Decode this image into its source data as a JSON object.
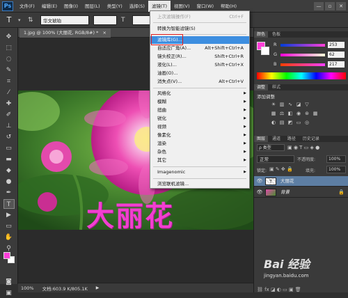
{
  "app": {
    "logo": "Ps"
  },
  "menubar": {
    "items": [
      "文件(F)",
      "编辑(E)",
      "图像(I)",
      "图层(L)",
      "类型(Y)",
      "选择(S)",
      "滤镜(T)",
      "视图(V)",
      "窗口(W)",
      "帮助(H)"
    ],
    "active_index": 6,
    "window_buttons": [
      "—",
      "▫",
      "✕"
    ]
  },
  "options_bar": {
    "tool_icon": "T",
    "font_family": "华文琥珀",
    "antialias_label": "aa"
  },
  "document": {
    "tab_label": "1.jpg @ 100% (大丽花, RGB/8#) *",
    "close_symbol": "×",
    "canvas_text": "大丽花"
  },
  "status_bar": {
    "zoom": "100%",
    "doc_info": "文档:603.9 K/805.1K"
  },
  "filter_menu": {
    "items": [
      {
        "label": "上次滤镜操作(F)",
        "shortcut": "Ctrl+F",
        "disabled": true
      },
      {
        "label": "转换为智能滤镜(S)",
        "shortcut": ""
      },
      {
        "label": "滤镜库(G)...",
        "shortcut": "",
        "highlighted": true
      },
      {
        "label": "自适应广角(A)...",
        "shortcut": "Alt+Shift+Ctrl+A"
      },
      {
        "label": "镜头校正(R)...",
        "shortcut": "Shift+Ctrl+R"
      },
      {
        "label": "液化(L)...",
        "shortcut": "Shift+Ctrl+X"
      },
      {
        "label": "油画(O)...",
        "shortcut": ""
      },
      {
        "label": "消失点(V)...",
        "shortcut": "Alt+Ctrl+V"
      },
      {
        "label": "风格化",
        "submenu": true
      },
      {
        "label": "模糊",
        "submenu": true
      },
      {
        "label": "扭曲",
        "submenu": true
      },
      {
        "label": "锐化",
        "submenu": true
      },
      {
        "label": "视频",
        "submenu": true
      },
      {
        "label": "像素化",
        "submenu": true
      },
      {
        "label": "渲染",
        "submenu": true
      },
      {
        "label": "杂色",
        "submenu": true
      },
      {
        "label": "其它",
        "submenu": true
      },
      {
        "label": "Imagenomic",
        "submenu": true
      },
      {
        "label": "浏览联机滤镜...",
        "shortcut": ""
      }
    ]
  },
  "color_panel": {
    "tabs": [
      "颜色",
      "色板"
    ],
    "channels": [
      {
        "label": "R",
        "value": "253"
      },
      {
        "label": "G",
        "value": "62"
      },
      {
        "label": "B",
        "value": "217"
      }
    ],
    "foreground_color": "#fd3ed9"
  },
  "adjustments_panel": {
    "tabs": [
      "调整",
      "样式"
    ],
    "heading": "添加调整"
  },
  "layers_panel": {
    "tabs": [
      "图层",
      "通道",
      "路径",
      "历史记录"
    ],
    "filter_label": "ρ 类型",
    "blend_mode": "正常",
    "opacity_label": "不透明度:",
    "opacity_value": "100%",
    "lock_label": "锁定:",
    "fill_label": "填充:",
    "fill_value": "100%",
    "layers": [
      {
        "name": "大丽花",
        "type": "text",
        "selected": true
      },
      {
        "name": "背景",
        "type": "image",
        "selected": false
      }
    ]
  },
  "watermark": {
    "brand": "Bai 经验",
    "url": "jingyan.baidu.com"
  }
}
